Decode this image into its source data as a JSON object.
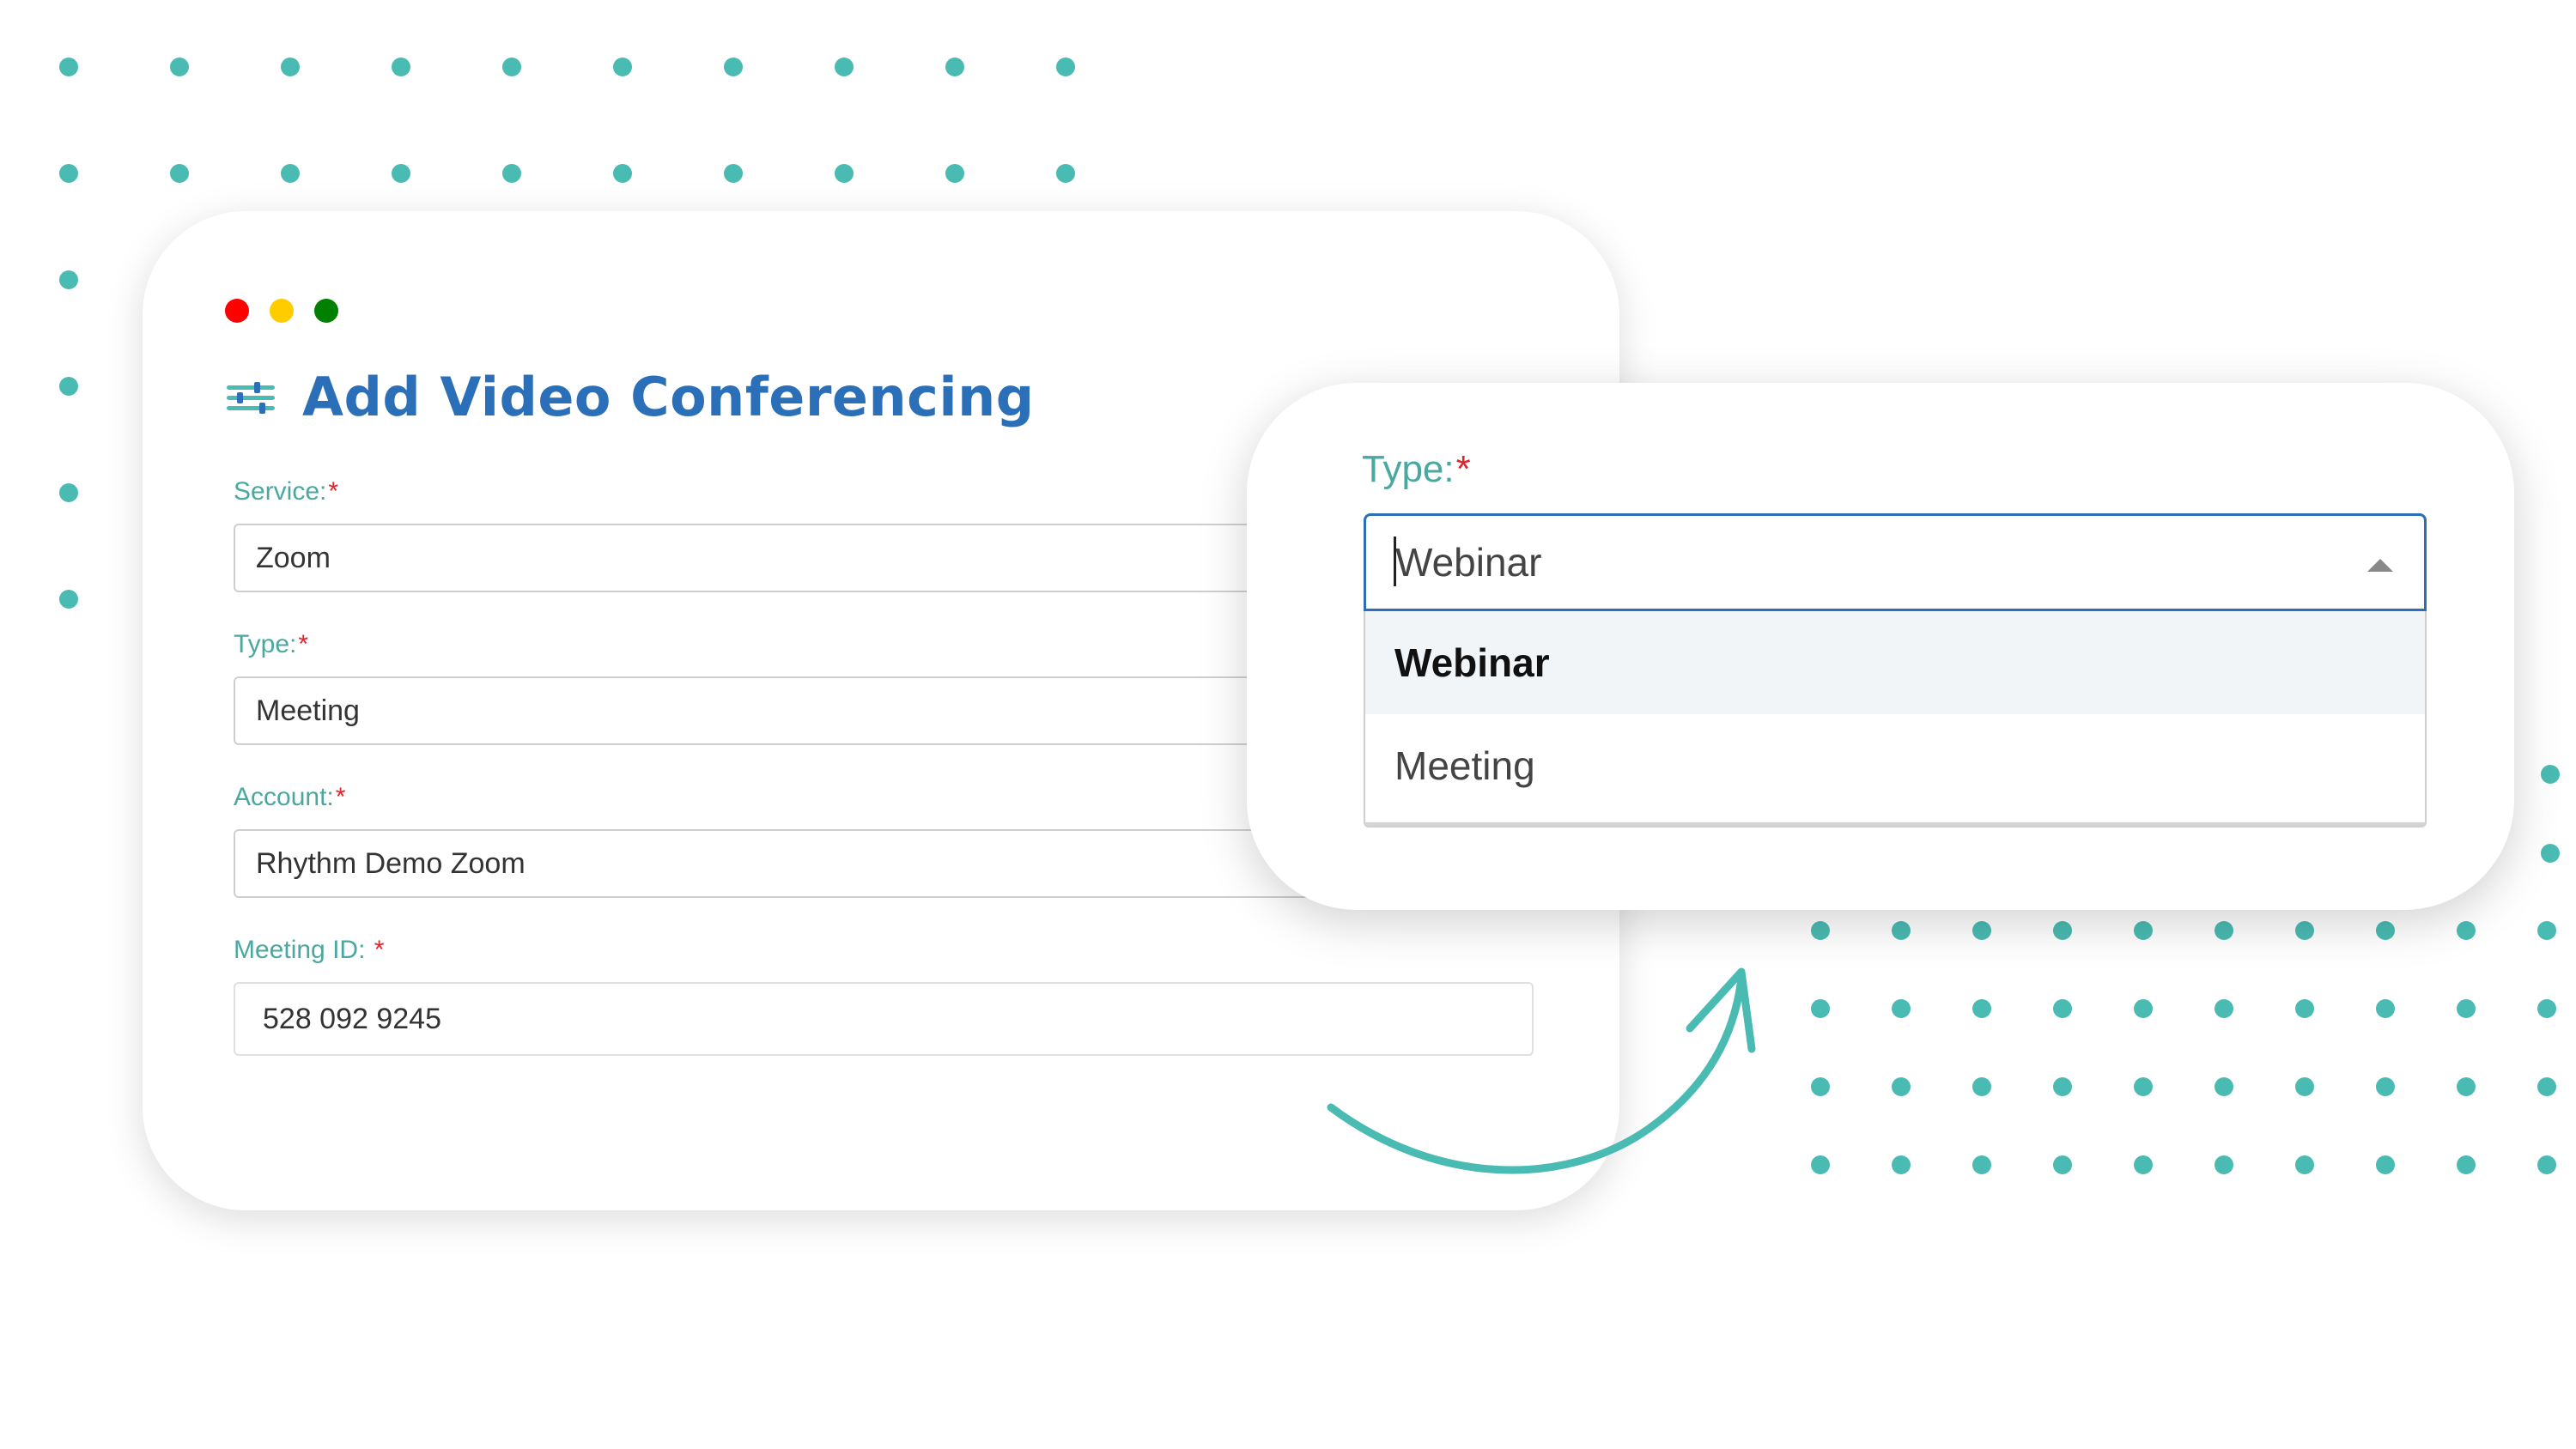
{
  "colors": {
    "accent": "#4abbb2",
    "title_blue": "#2b6fb8",
    "label_teal": "#4aa8a0",
    "required_red": "#e0262c",
    "traffic_red": "#ff0000",
    "traffic_yellow": "#ffcc00",
    "traffic_green": "#008000"
  },
  "window": {
    "title": "Add Video Conferencing",
    "title_icon": "sliders-icon"
  },
  "form": {
    "service": {
      "label": "Service:",
      "required": "*",
      "value": "Zoom"
    },
    "type": {
      "label": "Type:",
      "required": "*",
      "value": "Meeting"
    },
    "account": {
      "label": "Account:",
      "required": "*",
      "value": "Rhythm Demo Zoom"
    },
    "meeting_id": {
      "label": "Meeting ID: ",
      "required": "*",
      "value": "528 092 9245"
    }
  },
  "type_dropdown": {
    "label": "Type:",
    "required": "*",
    "value": "Webinar",
    "arrow_icon": "caret-up-icon",
    "options": [
      {
        "label": "Webinar",
        "highlighted": true
      },
      {
        "label": "Meeting",
        "highlighted": false
      }
    ]
  }
}
